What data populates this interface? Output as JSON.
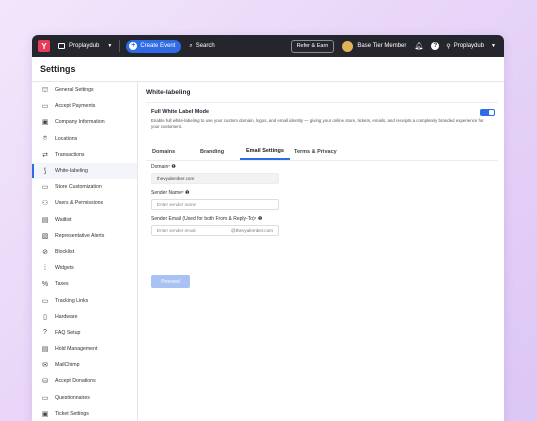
{
  "topbar": {
    "logo": "Y",
    "org_name": "Proplaydub",
    "create_event": "Create Event",
    "search": "Search",
    "refer": "Refer & Earn",
    "tier": "Base Tier Member",
    "user": "Proplaydub"
  },
  "settings_title": "Settings",
  "sidebar": {
    "items": [
      {
        "label": "General Settings",
        "icon": "bank-icon",
        "glyph": "⛫"
      },
      {
        "label": "Accept Payments",
        "icon": "payment-icon",
        "glyph": "▭"
      },
      {
        "label": "Company Information",
        "icon": "company-icon",
        "glyph": "▣"
      },
      {
        "label": "Locations",
        "icon": "location-icon",
        "glyph": "⌾"
      },
      {
        "label": "Transactions",
        "icon": "transactions-icon",
        "glyph": "⇄"
      },
      {
        "label": "White-labeling",
        "icon": "whitelabel-icon",
        "glyph": "⟆"
      },
      {
        "label": "Store Customization",
        "icon": "store-icon",
        "glyph": "▭"
      },
      {
        "label": "Users & Permissions",
        "icon": "users-icon",
        "glyph": "⚇"
      },
      {
        "label": "Waitlist",
        "icon": "waitlist-icon",
        "glyph": "▤"
      },
      {
        "label": "Representative Alerts",
        "icon": "alerts-icon",
        "glyph": "▧"
      },
      {
        "label": "Blocklist",
        "icon": "blocklist-icon",
        "glyph": "⊘"
      },
      {
        "label": "Widgets",
        "icon": "widgets-icon",
        "glyph": "⁞"
      },
      {
        "label": "Taxes",
        "icon": "taxes-icon",
        "glyph": "%"
      },
      {
        "label": "Tracking Links",
        "icon": "tracking-icon",
        "glyph": "▭"
      },
      {
        "label": "Hardware",
        "icon": "hardware-icon",
        "glyph": "▯"
      },
      {
        "label": "FAQ Setup",
        "icon": "faq-icon",
        "glyph": "?"
      },
      {
        "label": "Hold Management",
        "icon": "hold-icon",
        "glyph": "▤"
      },
      {
        "label": "MailChimp",
        "icon": "mailchimp-icon",
        "glyph": "✉"
      },
      {
        "label": "Accept Donations",
        "icon": "donations-icon",
        "glyph": "⛁"
      },
      {
        "label": "Questionnaires",
        "icon": "questionnaire-icon",
        "glyph": "▭"
      },
      {
        "label": "Ticket Settings",
        "icon": "ticket-icon",
        "glyph": "▣"
      }
    ],
    "active_index": 5
  },
  "main": {
    "title": "White-labeling",
    "full_white_label": {
      "title": "Full White Label Mode",
      "description": "Enable full white-labeling to use your custom domain, logos, and email identity — giving your online store, tickets, emails, and receipts a completely branded experience for your customers.",
      "enabled": true
    },
    "tabs": [
      "Domains",
      "Branding",
      "Email Settings",
      "Terms & Privacy"
    ],
    "active_tab": 2,
    "domain": {
      "label": "Domain",
      "value": "thevyalember.com"
    },
    "sender_name": {
      "label": "Sender Name",
      "placeholder": "Enter sender name"
    },
    "sender_email": {
      "label": "Sender Email (Used for both From & Reply-To)",
      "placeholder": "Enter sender email",
      "suffix": "@thevyalember.com"
    },
    "proceed": "Proceed"
  }
}
